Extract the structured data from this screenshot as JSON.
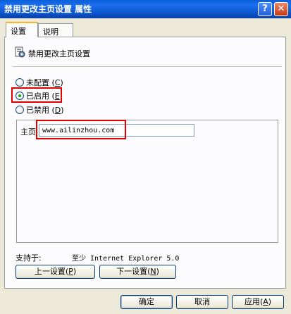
{
  "window": {
    "title": "禁用更改主页设置 属性",
    "help": "?",
    "close": "✕"
  },
  "tabs": [
    {
      "label": "设置"
    },
    {
      "label": "说明"
    }
  ],
  "policy": {
    "name": "禁用更改主页设置"
  },
  "options": [
    {
      "label": "未配置",
      "key": "C",
      "checked": false
    },
    {
      "label": "已启用",
      "key": "E",
      "checked": true
    },
    {
      "label": "已禁用",
      "key": "D",
      "checked": false
    }
  ],
  "homepage": {
    "label": "主页",
    "value": "www.ailinzhou.com"
  },
  "supported": {
    "label": "支持于:",
    "value": "至少 Internet Explorer 5.0"
  },
  "nav": {
    "prev_label": "上一设置",
    "prev_key": "P",
    "next_label": "下一设置",
    "next_key": "N"
  },
  "footer": {
    "ok_label": "确定",
    "cancel_label": "取消",
    "apply_label": "应用",
    "apply_key": "A"
  },
  "colors": {
    "highlight": "#e10000",
    "titlebar": "#0b53c9"
  }
}
